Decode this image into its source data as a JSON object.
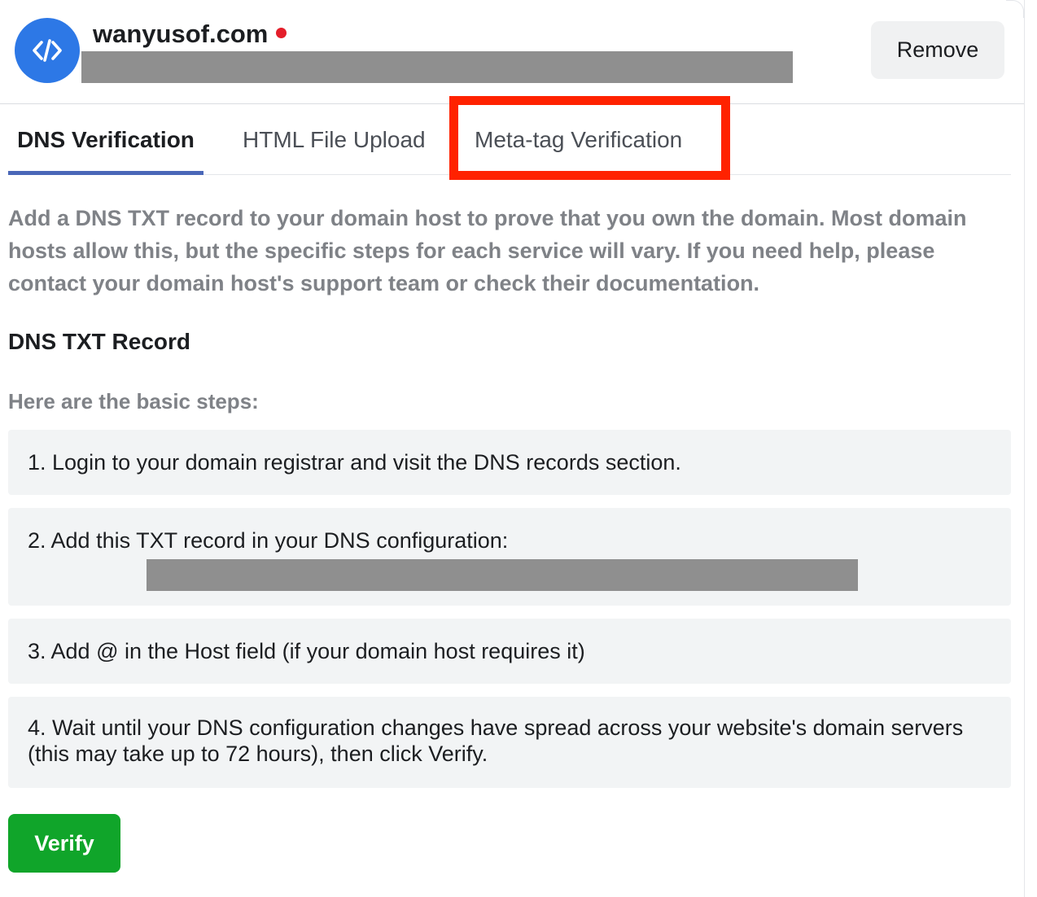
{
  "header": {
    "domain": "wanyusof.com",
    "icon": "code-icon",
    "status_color": "#e41e2a",
    "remove_label": "Remove"
  },
  "tabs": [
    {
      "label": "DNS Verification",
      "active": true
    },
    {
      "label": "HTML File Upload",
      "active": false
    },
    {
      "label": "Meta-tag Verification",
      "active": false,
      "highlighted": true
    }
  ],
  "intro": "Add a DNS TXT record to your domain host to prove that you own the domain. Most domain hosts allow this, but the specific steps for each service will vary. If you need help, please contact your domain host's support team or check their documentation.",
  "section_title": "DNS TXT Record",
  "steps_heading": "Here are the basic steps:",
  "steps": [
    "1. Login to your domain registrar and visit the DNS records section.",
    "2. Add this TXT record in your DNS configuration:",
    "3. Add @ in the Host field (if your domain host requires it)",
    "4. Wait until your DNS configuration changes have spread across your website's domain servers (this may take up to 72 hours), then click Verify."
  ],
  "verify_label": "Verify",
  "colors": {
    "icon_bg": "#2d78e6",
    "active_tab_underline": "#4a67b8",
    "highlight": "#ff2200",
    "verify_button": "#10a52a",
    "redaction": "#8f8f8f"
  }
}
